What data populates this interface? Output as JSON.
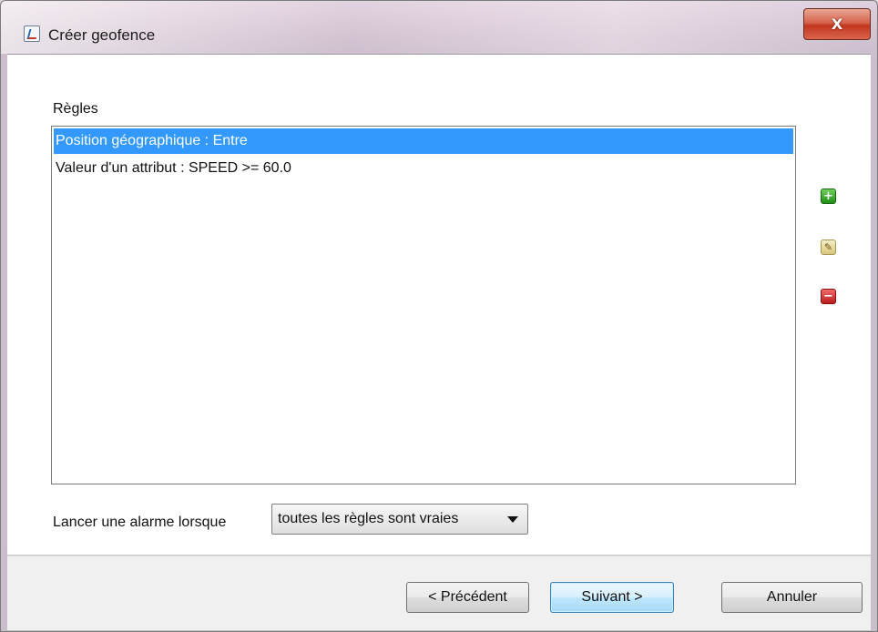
{
  "window": {
    "title": "Créer geofence",
    "close_label": "X"
  },
  "rules": {
    "label": "Règles",
    "items": [
      {
        "label": "Position géographique : Entre",
        "selected": true
      },
      {
        "label": "Valeur d'un attribut : SPEED >= 60.0",
        "selected": false
      }
    ]
  },
  "side_buttons": {
    "add_icon": "plus-icon",
    "edit_icon": "pencil-icon",
    "remove_icon": "minus-icon",
    "add_symbol": "+",
    "edit_symbol": "✎",
    "remove_symbol": "−",
    "add_color": "#2e9e21",
    "edit_color": "#d8c77d",
    "remove_color": "#c62828"
  },
  "alarm": {
    "label": "Lancer une alarme lorsque",
    "selected_value": "toutes les règles sont vraies"
  },
  "footer": {
    "prev_label": "< Précédent",
    "next_label": "Suivant >",
    "cancel_label": "Annuler"
  },
  "colors": {
    "selection": "#3399ff",
    "close_button": "#c2361f"
  }
}
